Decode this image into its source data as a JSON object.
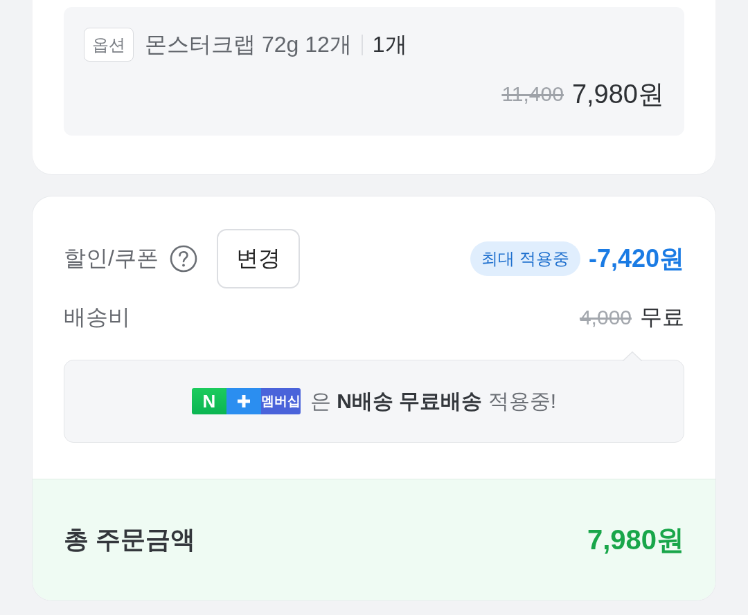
{
  "order_item": {
    "option_tag": "옵션",
    "option_name": "몬스터크랩 72g 12개",
    "quantity": "1개",
    "original_price": "11,400",
    "price": "7,980원"
  },
  "discount": {
    "label": "할인/쿠폰",
    "change_button": "변경",
    "badge": "최대 적용중",
    "amount": "-7,420원"
  },
  "shipping": {
    "label": "배송비",
    "original_fee": "4,000",
    "fee": "무료"
  },
  "membership_notice": {
    "logo_letter": "N",
    "logo_label": "멤버십",
    "text": "은 **N배송 무료배송** 적용중!"
  },
  "total": {
    "label": "총 주문금액",
    "amount": "7,980원"
  }
}
